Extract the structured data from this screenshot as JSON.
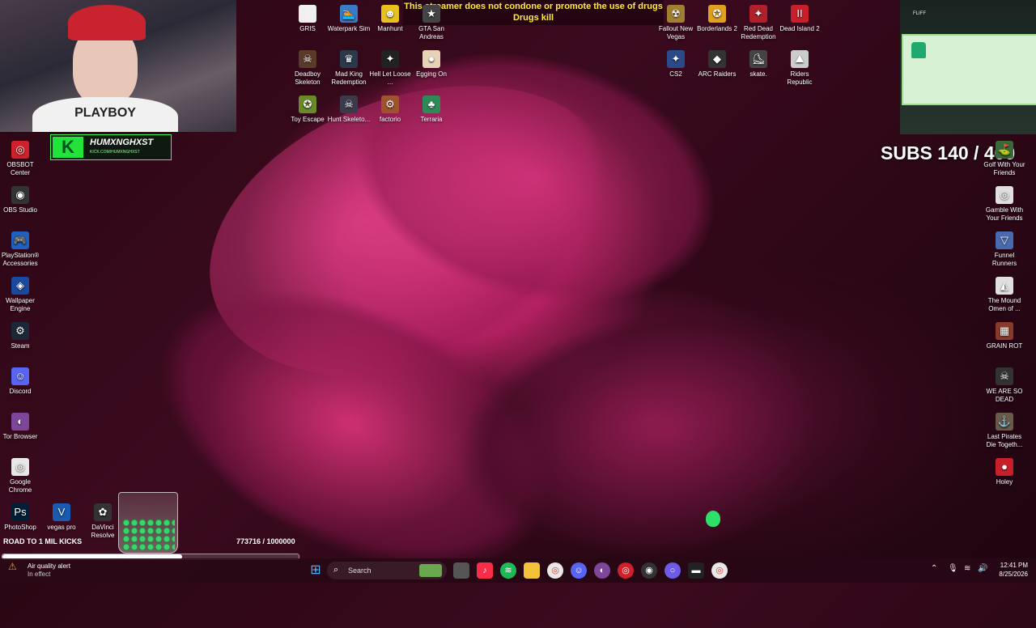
{
  "desktop_icons_top": [
    {
      "label": "GRIS",
      "color": "#f0f0f0",
      "glyph": " "
    },
    {
      "label": "Waterpark Sim",
      "color": "#3a7bc8",
      "glyph": "🏊"
    },
    {
      "label": "Manhunt",
      "color": "#e8c020",
      "glyph": "☻"
    },
    {
      "label": "GTA San Andreas",
      "color": "#444",
      "glyph": "★"
    },
    {
      "label": "Deadboy Skeleton",
      "color": "#5a3a2a",
      "glyph": "☠"
    },
    {
      "label": "Mad King Redemption",
      "color": "#2a3a4a",
      "glyph": "♛"
    },
    {
      "label": "Hell Let Loose ...",
      "color": "#222",
      "glyph": "✦"
    },
    {
      "label": "Egging On",
      "color": "#e8d2b8",
      "glyph": "●"
    },
    {
      "label": "Toy Escape",
      "color": "#6a8a2a",
      "glyph": "✪"
    },
    {
      "label": "Hunt Skeleto...",
      "color": "#3a3a4a",
      "glyph": "☠"
    },
    {
      "label": "factorio",
      "color": "#a0522d",
      "glyph": "⚙"
    },
    {
      "label": "Terraria",
      "color": "#2e8b57",
      "glyph": "♣"
    }
  ],
  "desktop_icons_topright": [
    {
      "label": "Fallout New Vegas",
      "color": "#a08030",
      "glyph": "☢"
    },
    {
      "label": "Borderlands 2",
      "color": "#e0a020",
      "glyph": "✪"
    },
    {
      "label": "Red Dead Redemption",
      "color": "#b0202a",
      "glyph": "✦"
    },
    {
      "label": "Dead Island 2",
      "color": "#c8202a",
      "glyph": "II"
    },
    {
      "label": "CS2",
      "color": "#2a4a8a",
      "glyph": "✦"
    },
    {
      "label": "ARC Raiders",
      "color": "#333",
      "glyph": "◆"
    },
    {
      "label": "skate.",
      "color": "#444",
      "glyph": "⛸"
    },
    {
      "label": "Riders Republic",
      "color": "#ccc",
      "glyph": "⛰"
    }
  ],
  "desktop_icons_left": [
    {
      "label": "OBSBOT Center",
      "color": "#d0202a",
      "glyph": "◎"
    },
    {
      "label": "OBS Studio",
      "color": "#333",
      "glyph": "◉"
    },
    {
      "label": "PlayStation® Accessories",
      "color": "#2060c0",
      "glyph": "🎮"
    },
    {
      "label": "Wallpaper Engine",
      "color": "#1a4aa0",
      "glyph": "◈"
    },
    {
      "label": "Steam",
      "color": "#1b2838",
      "glyph": "⚙"
    },
    {
      "label": "Discord",
      "color": "#5865f2",
      "glyph": "☺"
    },
    {
      "label": "Tor Browser",
      "color": "#7d4698",
      "glyph": "◐"
    },
    {
      "label": "Google Chrome",
      "color": "#e8e8e8",
      "glyph": "◎"
    }
  ],
  "desktop_icons_bottomleft": [
    {
      "label": "PhotoShop",
      "color": "#001e36",
      "glyph": "Ps"
    },
    {
      "label": "vegas pro",
      "color": "#1a5ab0",
      "glyph": "V"
    },
    {
      "label": "DaVinci Resolve",
      "color": "#333",
      "glyph": "✿"
    }
  ],
  "desktop_icons_right": [
    {
      "label": "Golf With Your Friends",
      "color": "#3a6a3a",
      "glyph": "⛳"
    },
    {
      "label": "Gamble With Your Friends",
      "color": "#e0e0e0",
      "glyph": "◎"
    },
    {
      "label": "Funnel Runners",
      "color": "#4a6ab0",
      "glyph": "▽"
    },
    {
      "label": "The Mound Omen of ...",
      "color": "#e0e0e0",
      "glyph": "◭"
    },
    {
      "label": "GRAIN ROT",
      "color": "#8a3a2a",
      "glyph": "▦"
    },
    {
      "label": "WE ARE SO DEAD",
      "color": "#333",
      "glyph": "☠"
    },
    {
      "label": "Last Pirates Die Togeth...",
      "color": "#6a5a4a",
      "glyph": "⚓"
    },
    {
      "label": "Holey",
      "color": "#c8202a",
      "glyph": "●"
    }
  ],
  "banner": {
    "line1": "This streamer does not condone or promote the use of drugs",
    "line2": "Drugs kill"
  },
  "webcam": {
    "shirt_text": "PLAYBOY"
  },
  "kick_badge": {
    "logo": "K",
    "name": "HUMXNGHXST",
    "url": "KICK.COM/HUMXNGHXST"
  },
  "cam2": {
    "tag": "FLIFF"
  },
  "subs": "SUBS 140 / 400",
  "kicks_goal": {
    "label": "ROAD TO 1 MIL KICKS",
    "count": "773716 / 1000000",
    "progress": 0.773716
  },
  "taskbar": {
    "alert_title": "Air quality alert",
    "alert_sub": "In effect",
    "search_placeholder": "Search",
    "time": "12:41 PM",
    "date": "8/25/2026"
  },
  "accent": "#e23c86"
}
